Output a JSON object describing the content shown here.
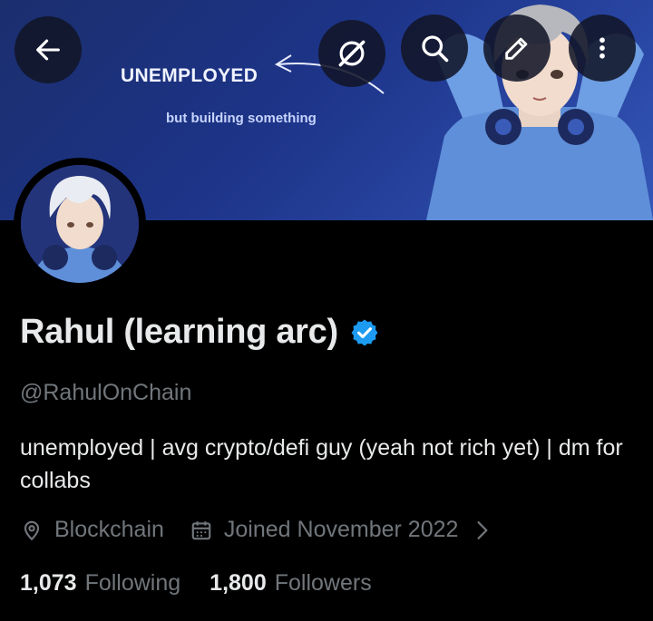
{
  "banner": {
    "headline": "UNEMPLOYED",
    "subline": "but building something"
  },
  "header_buttons": {
    "back": "arrow-left-icon",
    "grok": "grok-icon",
    "search": "search-icon",
    "edit": "edit-icon",
    "more": "more-vertical-icon"
  },
  "profile": {
    "display_name": "Rahul (learning arc)",
    "verified": true,
    "handle": "@RahulOnChain",
    "bio": "unemployed | avg crypto/defi guy (yeah not rich yet) | dm for collabs",
    "location": "Blockchain",
    "joined": "Joined November 2022",
    "following_count": "1,073",
    "following_label": "Following",
    "followers_count": "1,800",
    "followers_label": "Followers"
  },
  "colors": {
    "background": "#000000",
    "primary_text": "#e7e9ea",
    "secondary_text": "#71767b",
    "verified_blue": "#1d9bf0",
    "banner_blue": "#1f3a8f"
  }
}
